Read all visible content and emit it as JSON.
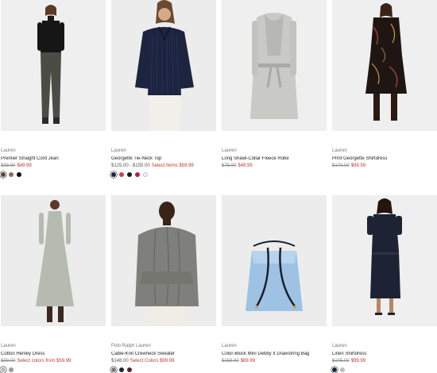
{
  "products": [
    {
      "brand": "Lauren",
      "name": "Premier Straight Cord Jean",
      "original_price": "$99.00",
      "sale_price": "$49.99",
      "sale_label": "",
      "swatches": [
        "#4a4a44",
        "#8c6f55",
        "#111111"
      ],
      "image": "woman-black-turtleneck-grey-jeans"
    },
    {
      "brand": "Lauren",
      "name": "Georgette Tie-Neck Top",
      "original_price": "",
      "regular_price": "$125.00 - $155.00",
      "sale_price": "Select Items $59.99",
      "sale_label": "",
      "swatches": [
        "#1b2540",
        "#c8464a",
        "#1a1a1a",
        "#b3243c",
        "#f5f5f5"
      ],
      "image": "woman-navy-pleated-blouse"
    },
    {
      "brand": "Lauren",
      "name": "Long Shawl-Collar Fleece Robe",
      "original_price": "$78.00",
      "sale_price": "$49.99",
      "sale_label": "",
      "swatches": [],
      "image": "grey-fleece-robe"
    },
    {
      "brand": "Lauren",
      "name": "Print Georgette Shirtdress",
      "original_price": "$170.00",
      "sale_price": "$99.99",
      "sale_label": "",
      "swatches": [],
      "image": "woman-print-shirtdress-boots"
    },
    {
      "brand": "Lauren",
      "name": "Cotton Henley Dress",
      "original_price": "$99.00",
      "sale_price": "Select colors from $59.99",
      "sale_label": "",
      "swatches": [
        "#b9bdb2",
        "#9a9a9a"
      ],
      "image": "woman-sage-henley-dress"
    },
    {
      "brand": "Polo Ralph Lauren",
      "name": "Cable-Knit Crewneck Sweater",
      "original_price": "",
      "regular_price": "$148.00",
      "sale_price": "Select Colors $99.99",
      "sale_label": "",
      "swatches": [
        "#7a7a7a",
        "#1c2444",
        "#5a1f2e"
      ],
      "image": "woman-grey-cable-sweater"
    },
    {
      "brand": "Lauren",
      "name": "Color-Block Mini Debby II Drawstring Bag",
      "original_price": "$158.00",
      "sale_price": "$89.99",
      "sale_label": "",
      "swatches": [],
      "image": "blue-bucket-bag"
    },
    {
      "brand": "Lauren",
      "name": "Linen Shirtdress",
      "original_price": "$145.00",
      "sale_price": "$99.99",
      "sale_label": "",
      "swatches": [
        "#1c2444",
        "#c9c0a6"
      ],
      "image": "woman-navy-linen-shirtdress"
    }
  ]
}
